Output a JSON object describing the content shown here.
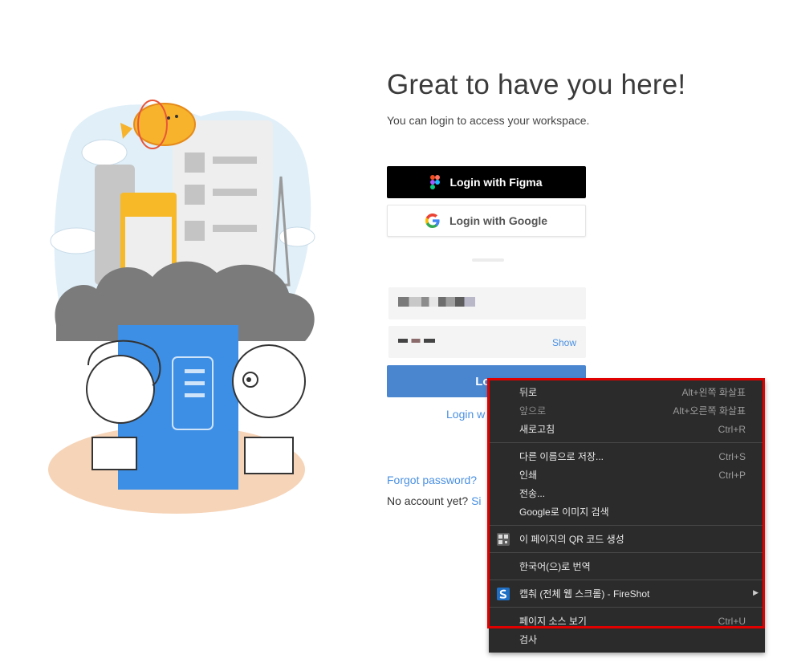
{
  "heading": {
    "title": "Great to have you here!",
    "subtitle": "You can login to access your workspace."
  },
  "auth": {
    "figma_label": "Login with Figma",
    "google_label": "Login with Google",
    "email_placeholder": "",
    "password_show": "Show",
    "login_label": "Log",
    "login_sso_label": "Login w",
    "forgot_password": "Forgot password?",
    "no_account": "No account yet?",
    "signup_partial": "Si"
  },
  "context_menu": {
    "items": [
      {
        "label": "뒤로",
        "shortcut": "Alt+왼쪽 화살표"
      },
      {
        "label": "앞으로",
        "shortcut": "Alt+오른쪽 화살표",
        "disabled": true
      },
      {
        "label": "새로고침",
        "shortcut": "Ctrl+R"
      },
      {
        "label": "다른 이름으로 저장...",
        "shortcut": "Ctrl+S"
      },
      {
        "label": "인쇄",
        "shortcut": "Ctrl+P"
      },
      {
        "label": "전송...",
        "shortcut": ""
      },
      {
        "label": "Google로 이미지 검색",
        "shortcut": ""
      },
      {
        "label": "이 페이지의 QR 코드 생성",
        "shortcut": "",
        "icon": "qr-code-icon"
      },
      {
        "label": "한국어(으)로 번역",
        "shortcut": ""
      },
      {
        "label": "캡춰 (전체 웹 스크롤) - FireShot",
        "shortcut": "",
        "icon": "fireshot-icon"
      },
      {
        "label": "페이지 소스 보기",
        "shortcut": "Ctrl+U"
      },
      {
        "label": "검사",
        "shortcut": ""
      }
    ]
  },
  "colors": {
    "accent": "#4a90e2",
    "login_button": "#4a86d0",
    "menu_bg": "#2b2b2b",
    "highlight": "#e00000"
  }
}
